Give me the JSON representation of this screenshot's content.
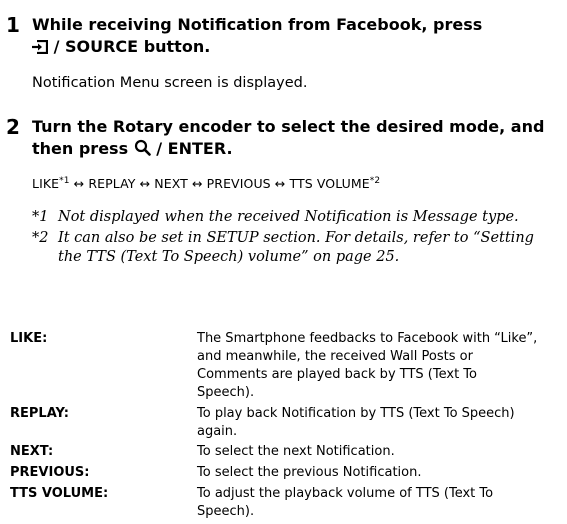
{
  "steps": [
    {
      "number": "1",
      "heading_line1": "While receiving Notification from Facebook, press",
      "button_label": "/ SOURCE",
      "heading_suffix": "button.",
      "description": "Notification Menu screen is displayed."
    },
    {
      "number": "2",
      "heading_part1": "Turn the ",
      "heading_bold_term": "Rotary encoder",
      "heading_part2": " to select the desired mode, and",
      "heading_line2_prefix": "then press ",
      "button_label": "/ ENTER.",
      "mode_sequence": {
        "m1": "LIKE",
        "sup1": "*1",
        "arrow": " ↔ ",
        "m2": "REPLAY",
        "m3": "NEXT",
        "m4": "PREVIOUS",
        "m5": "TTS VOLUME",
        "sup2": "*2"
      },
      "notes": [
        {
          "mark": "*1",
          "line1": "Not displayed when the received Notification is Message type."
        },
        {
          "mark": "*2",
          "line1": "It can also be set in SETUP section. For details, refer to “Setting",
          "line2": "the TTS (Text To Speech) volume” on page 25."
        }
      ]
    }
  ],
  "definitions": [
    {
      "term": "LIKE:",
      "lines": [
        "The Smartphone feedbacks to Facebook with “Like”,",
        "and meanwhile, the received Wall Posts or",
        "Comments are played back by TTS (Text To",
        "Speech)."
      ]
    },
    {
      "term": "REPLAY:",
      "lines": [
        "To play back Notification by TTS (Text To Speech)",
        "again."
      ]
    },
    {
      "term": "NEXT:",
      "lines": [
        "To select the next Notification."
      ]
    },
    {
      "term": "PREVIOUS:",
      "lines": [
        "To select the previous Notification."
      ]
    },
    {
      "term": "TTS VOLUME:",
      "lines": [
        "To adjust the playback volume of TTS (Text To",
        "Speech)."
      ]
    }
  ],
  "icons": {
    "source": "source-input-icon",
    "enter": "magnifier-icon"
  }
}
